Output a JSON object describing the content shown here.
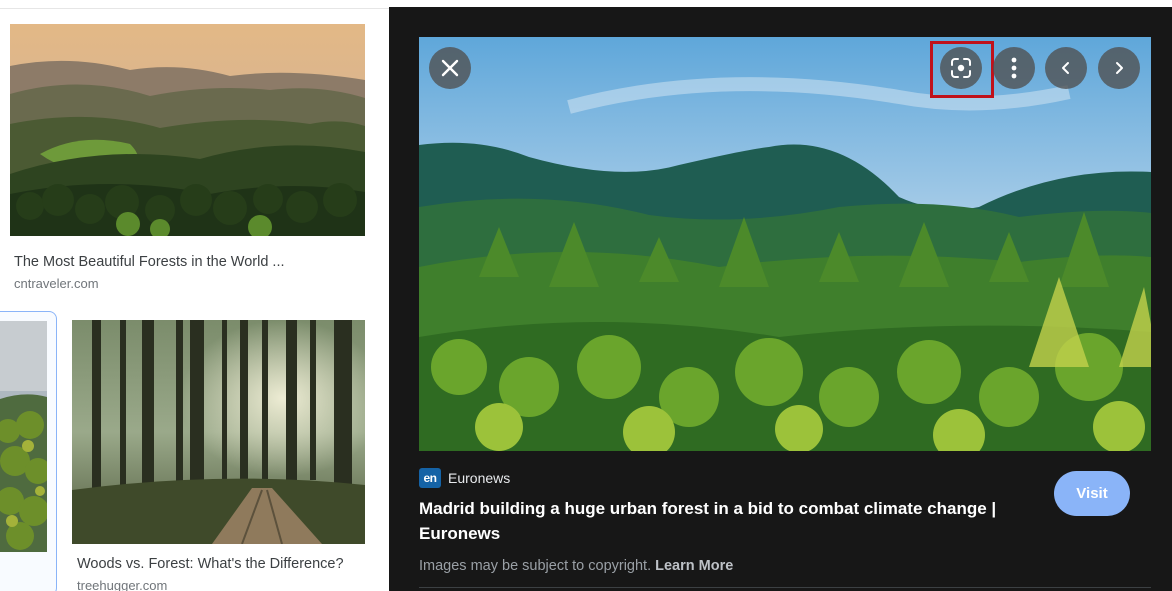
{
  "results": [
    {
      "title": "The Most Beautiful Forests in the World ...",
      "source": "cntraveler.com",
      "image": "forest-hills-sunrise-image"
    },
    {
      "title": "",
      "source": "",
      "image": "forest-partial-image",
      "selected": true
    },
    {
      "title": "Woods vs. Forest: What's the Difference?",
      "source": "treehugger.com",
      "image": "sunlit-woods-image"
    }
  ],
  "preview": {
    "image": "green-forest-mountains-image",
    "controls": {
      "close_icon": "close-icon",
      "lens_icon": "google-lens-icon",
      "more_icon": "more-vert-icon",
      "prev_icon": "chevron-left-icon",
      "next_icon": "chevron-right-icon"
    },
    "source_logo": "en",
    "source_name": "Euronews",
    "headline": "Madrid building a huge urban forest in a bid to combat climate change | Euronews",
    "visit_label": "Visit",
    "copyright_text": "Images may be subject to copyright.",
    "learn_more_label": "Learn More"
  },
  "colors": {
    "panel_bg": "#171717",
    "accent": "#8ab4f8",
    "highlight": "#c0111b",
    "source_logo_bg": "#1563a6"
  }
}
